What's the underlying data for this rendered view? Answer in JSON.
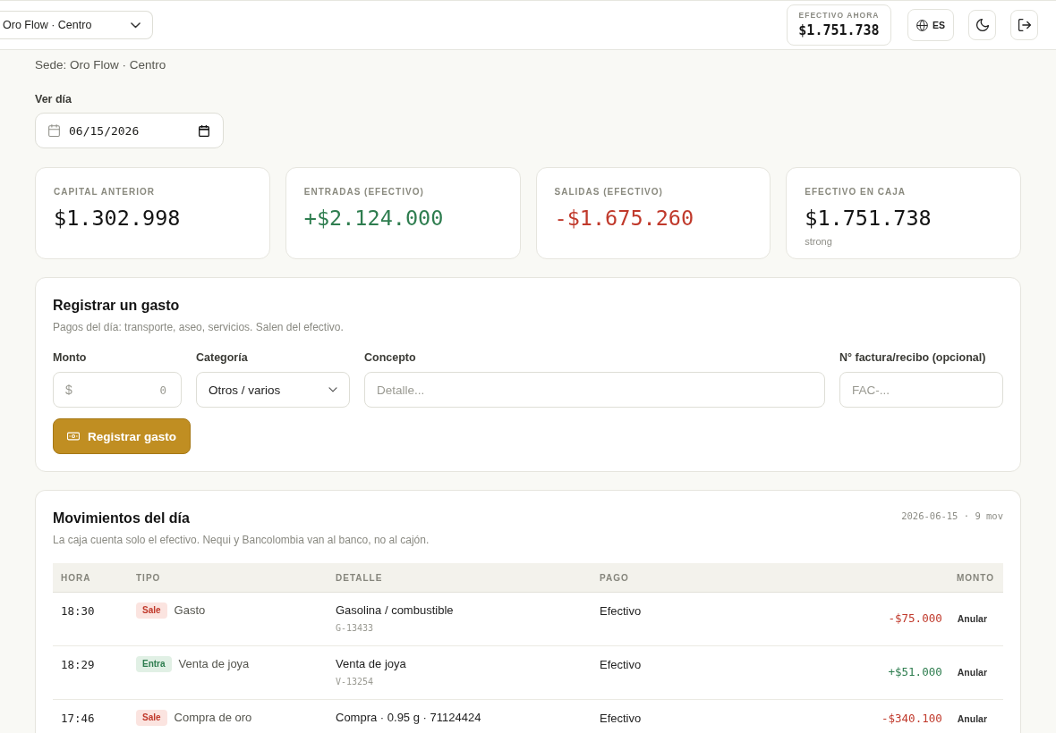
{
  "header": {
    "branch_select": {
      "value": "Oro Flow · Centro"
    },
    "cash_now": {
      "label": "EFECTIVO AHORA",
      "value": "$1.751.738"
    },
    "language_button": {
      "label": "ES"
    }
  },
  "page": {
    "branch_line": "Sede: Oro Flow · Centro"
  },
  "day_picker": {
    "label": "Ver día",
    "value": "06/15/2026"
  },
  "summary_cards": [
    {
      "kind": "neutral",
      "label": "CAPITAL ANTERIOR",
      "value": "$1.302.998"
    },
    {
      "kind": "income",
      "label": "ENTRADAS (EFECTIVO)",
      "value": "+$2.124.000"
    },
    {
      "kind": "expense",
      "label": "SALIDAS (EFECTIVO)",
      "value": "-$1.675.260"
    },
    {
      "kind": "neutral",
      "label": "EFECTIVO EN CAJA",
      "value": "$1.751.738",
      "note": "strong"
    }
  ],
  "expense_form": {
    "title": "Registrar un gasto",
    "subtitle": "Pagos del día: transporte, aseo, servicios. Salen del efectivo.",
    "fields": [
      {
        "kind": "amount",
        "label": "Monto",
        "prefix": "$",
        "placeholder": "0"
      },
      {
        "kind": "select",
        "label": "Categoría",
        "value": "Otros / varios"
      },
      {
        "kind": "text",
        "label": "Concepto",
        "placeholder": "Detalle..."
      },
      {
        "kind": "text",
        "label": "N° factura/recibo (opcional)",
        "placeholder": "FAC-..."
      }
    ],
    "submit_button": {
      "label": "Registrar gasto"
    }
  },
  "movements": {
    "title": "Movimientos del día",
    "subtitle": "La caja cuenta solo el efectivo. Nequi y Bancolombia van al banco, no al cajón.",
    "meta": "2026-06-15 · 9 mov",
    "table": {
      "columns": [
        "HORA",
        "TIPO",
        "DETALLE",
        "PAGO",
        "MONTO"
      ],
      "rows": [
        {
          "kind": "out",
          "time": "18:30",
          "badge": "Sale",
          "type": "Gasto",
          "detail": "Gasolina / combustible",
          "reference": "G-13433",
          "payment": "Efectivo",
          "amount": "-$75.000",
          "action": "Anular"
        },
        {
          "kind": "in",
          "time": "18:29",
          "badge": "Entra",
          "type": "Venta de joya",
          "detail": "Venta de joya",
          "reference": "V-13254",
          "payment": "Efectivo",
          "amount": "+$51.000",
          "action": "Anular"
        },
        {
          "kind": "out",
          "time": "17:46",
          "badge": "Sale",
          "type": "Compra de oro",
          "detail": "Compra · 0.95 g · 71124424",
          "payment": "Efectivo",
          "amount": "-$340.100",
          "action": "Anular"
        }
      ]
    }
  }
}
